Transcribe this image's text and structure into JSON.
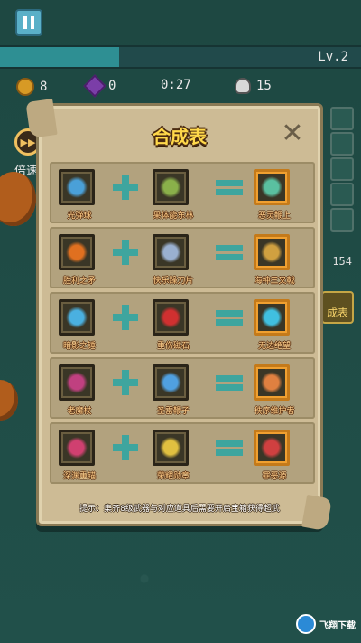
{
  "hud": {
    "level": "Lv.2",
    "xp_progress": 0.33,
    "coins": "8",
    "gems": "0",
    "timer": "0:27",
    "kills": "15",
    "speed_label": "倍速",
    "side_count": "154",
    "side_button_label": "成表"
  },
  "panel": {
    "title": "合成表",
    "hint": "提示：集齐8级武器与对应道具后需要开启宝箱获得超武",
    "recipes": [
      {
        "weapon": {
          "name": "光弹球",
          "icon": "wand-icon",
          "color": "#4aa0d8"
        },
        "item": {
          "name": "果体能东林",
          "icon": "leaf-creature-icon",
          "color": "#8ab04a"
        },
        "result": {
          "name": "恶灵鞭上",
          "icon": "spirit-icon",
          "color": "#5ac0a0"
        }
      },
      {
        "weapon": {
          "name": "胜利之矛",
          "icon": "spear-icon",
          "color": "#e07020"
        },
        "item": {
          "name": "快乐躁刀片",
          "icon": "blade-icon",
          "color": "#9ab0d0"
        },
        "result": {
          "name": "海神三叉戟",
          "icon": "trident-icon",
          "color": "#d0a040"
        }
      },
      {
        "weapon": {
          "name": "暗影之锤",
          "icon": "hammer-icon",
          "color": "#4ab0e0"
        },
        "item": {
          "name": "重伤磁石",
          "icon": "crystal-icon",
          "color": "#d03030"
        },
        "result": {
          "name": "无边绝望",
          "icon": "despair-icon",
          "color": "#40c0e0"
        }
      },
      {
        "weapon": {
          "name": "老魔杖",
          "icon": "staff-icon",
          "color": "#c04080"
        },
        "item": {
          "name": "圣雷鞭子",
          "icon": "lightning-icon",
          "color": "#50a0e0"
        },
        "result": {
          "name": "秩序维护者",
          "icon": "guardian-icon",
          "color": "#e08040"
        }
      },
      {
        "weapon": {
          "name": "深渊重锚",
          "icon": "anchor-icon",
          "color": "#d04070"
        },
        "item": {
          "name": "荣耀勋章",
          "icon": "medal-icon",
          "color": "#e0c040"
        },
        "result": {
          "name": "罪恶源",
          "icon": "sin-icon",
          "color": "#d04040"
        }
      }
    ]
  },
  "watermark": {
    "text": "飞翔下载"
  }
}
